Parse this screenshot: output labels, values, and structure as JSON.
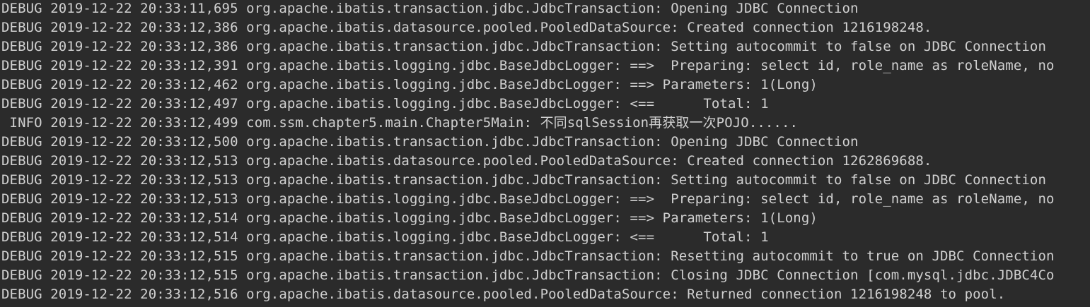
{
  "console": {
    "text_color": "#d0d0d0",
    "background": "#2b2b2b",
    "lines": [
      "DEBUG 2019-12-22 20:33:11,695 org.apache.ibatis.transaction.jdbc.JdbcTransaction: Opening JDBC Connection",
      "DEBUG 2019-12-22 20:33:12,386 org.apache.ibatis.datasource.pooled.PooledDataSource: Created connection 1216198248.",
      "DEBUG 2019-12-22 20:33:12,386 org.apache.ibatis.transaction.jdbc.JdbcTransaction: Setting autocommit to false on JDBC Connection",
      "DEBUG 2019-12-22 20:33:12,391 org.apache.ibatis.logging.jdbc.BaseJdbcLogger: ==>  Preparing: select id, role_name as roleName, no",
      "DEBUG 2019-12-22 20:33:12,462 org.apache.ibatis.logging.jdbc.BaseJdbcLogger: ==> Parameters: 1(Long)",
      "DEBUG 2019-12-22 20:33:12,497 org.apache.ibatis.logging.jdbc.BaseJdbcLogger: <==      Total: 1",
      " INFO 2019-12-22 20:33:12,499 com.ssm.chapter5.main.Chapter5Main: 不同sqlSession再获取一次POJO......",
      "DEBUG 2019-12-22 20:33:12,500 org.apache.ibatis.transaction.jdbc.JdbcTransaction: Opening JDBC Connection",
      "DEBUG 2019-12-22 20:33:12,513 org.apache.ibatis.datasource.pooled.PooledDataSource: Created connection 1262869688.",
      "DEBUG 2019-12-22 20:33:12,513 org.apache.ibatis.transaction.jdbc.JdbcTransaction: Setting autocommit to false on JDBC Connection",
      "DEBUG 2019-12-22 20:33:12,513 org.apache.ibatis.logging.jdbc.BaseJdbcLogger: ==>  Preparing: select id, role_name as roleName, no",
      "DEBUG 2019-12-22 20:33:12,514 org.apache.ibatis.logging.jdbc.BaseJdbcLogger: ==> Parameters: 1(Long)",
      "DEBUG 2019-12-22 20:33:12,514 org.apache.ibatis.logging.jdbc.BaseJdbcLogger: <==      Total: 1",
      "DEBUG 2019-12-22 20:33:12,515 org.apache.ibatis.transaction.jdbc.JdbcTransaction: Resetting autocommit to true on JDBC Connection",
      "DEBUG 2019-12-22 20:33:12,515 org.apache.ibatis.transaction.jdbc.JdbcTransaction: Closing JDBC Connection [com.mysql.jdbc.JDBC4Co",
      "DEBUG 2019-12-22 20:33:12,516 org.apache.ibatis.datasource.pooled.PooledDataSource: Returned connection 1216198248 to pool."
    ]
  }
}
